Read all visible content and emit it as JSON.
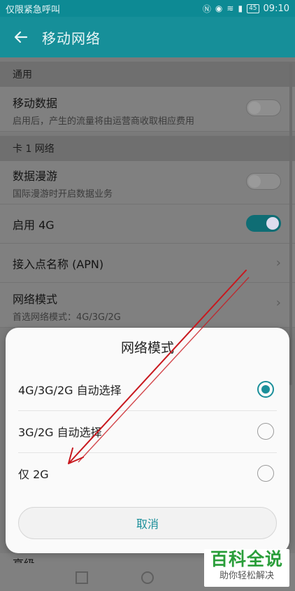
{
  "status_bar": {
    "left_text": "仅限紧急呼叫",
    "battery": "45",
    "time": "09:10"
  },
  "app_bar": {
    "title": "移动网络",
    "back_icon": "arrow-left-icon"
  },
  "sections": {
    "general": "通用",
    "sim1": "卡 1 网络"
  },
  "settings": {
    "mobile_data": {
      "title": "移动数据",
      "subtitle": "启用后，产生的流量将由运营商收取相应费用",
      "enabled": false
    },
    "roaming": {
      "title": "数据漫游",
      "subtitle": "国际漫游时开启数据业务",
      "enabled": false
    },
    "enable_4g": {
      "title": "启用 4G",
      "enabled": true
    },
    "apn": {
      "title": "接入点名称 (APN)"
    },
    "network_mode": {
      "title": "网络模式",
      "subtitle": "首选网络模式：4G/3G/2G"
    },
    "advanced_partial": "高级"
  },
  "dialog": {
    "title": "网络模式",
    "options": [
      {
        "label": "4G/3G/2G 自动选择",
        "selected": true
      },
      {
        "label": "3G/2G 自动选择",
        "selected": false
      },
      {
        "label": "仅 2G",
        "selected": false
      }
    ],
    "cancel": "取消"
  },
  "watermark": {
    "title": "百科全说",
    "subtitle": "助你轻松解决"
  },
  "colors": {
    "accent": "#1a8f9a",
    "appbar": "#168f99",
    "annotation_arrow": "#c8181e"
  }
}
